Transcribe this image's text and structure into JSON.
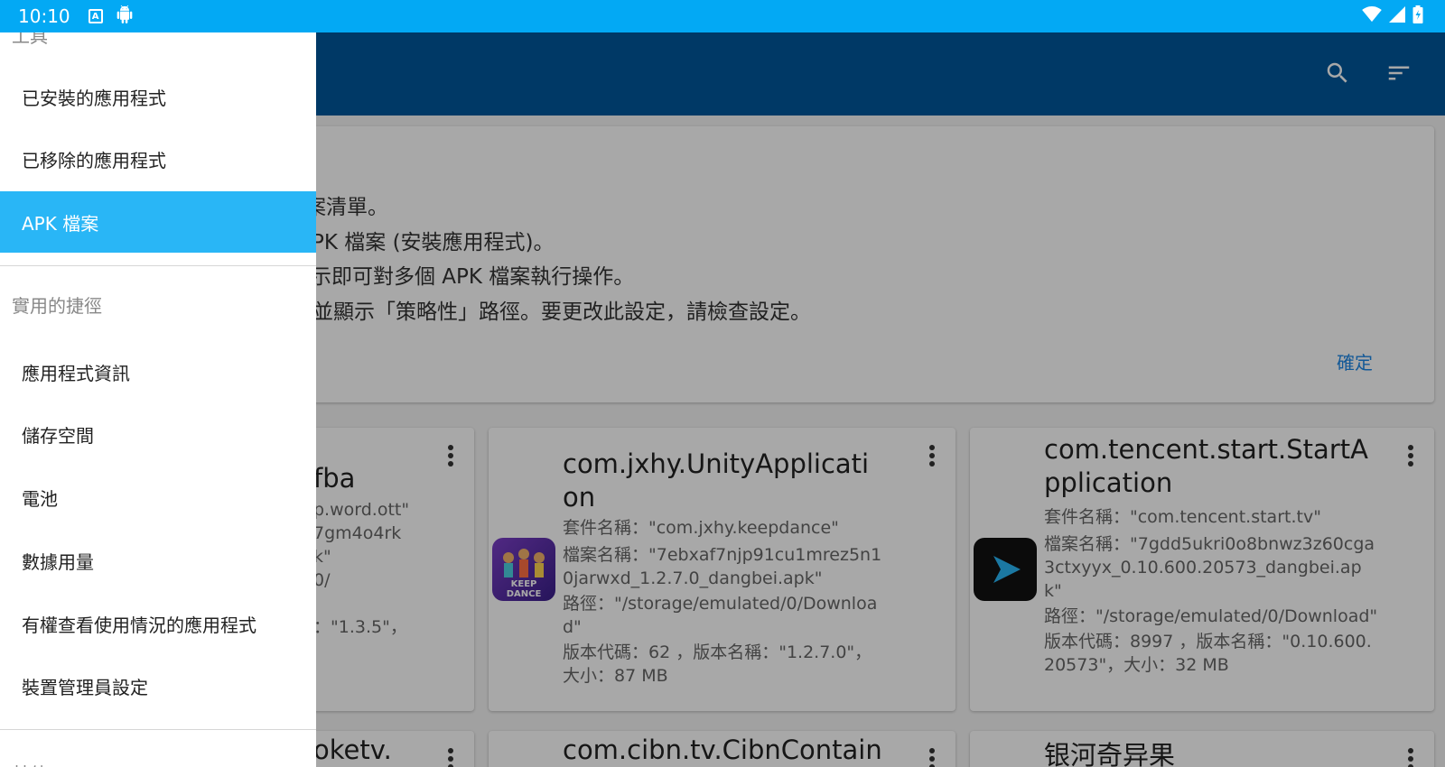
{
  "status_bar": {
    "time": "10:10",
    "notif_a": "A"
  },
  "app_bar": {
    "search_icon": "search-icon",
    "sort_icon": "sort-icon"
  },
  "info_card": {
    "lines": [
      "案清單。",
      "PK 檔案 (安裝應用程式)。",
      "示即可對多個 APK 檔案執行操作。",
      "並顯示「策略性」路徑。要更改此設定，請檢查設定。"
    ],
    "ok_label": "確定"
  },
  "cards": [
    {
      "title": "fba",
      "meta": [
        "p.word.ott\"",
        "7gm4o4rk",
        "k\"",
        "0/",
        "：\"1.3.5\"，"
      ]
    },
    {
      "title": "com.jxhy.UnityApplication",
      "meta": [
        "套件名稱：\"com.jxhy.keepdance\"",
        "檔案名稱：\"7ebxaf7njp91cu1mrez5n10jarwxd_1.2.7.0_dangbei.apk\"",
        "路徑：\"/storage/emulated/0/Download\"",
        "版本代碼：62 ，版本名稱：\"1.2.7.0\"，大小：87 MB"
      ],
      "icon_text": "KEEP DANCE"
    },
    {
      "title": "com.tencent.start.StartApplication",
      "meta": [
        "套件名稱：\"com.tencent.start.tv\"",
        "檔案名稱：\"7gdd5ukri0o8bnwz3z60cga3ctxyyx_0.10.600.20573_dangbei.apk\"",
        "路徑：\"/storage/emulated/0/Download\"",
        "版本代碼：8997 ，版本名稱：\"0.10.600.20573\"，大小：32 MB"
      ]
    }
  ],
  "cards_row2": [
    "oketv.",
    "com.cibn.tv.CibnContain",
    "银河奇异果"
  ],
  "drawer": {
    "top_section": "工具",
    "tools": [
      "已安裝的應用程式",
      "已移除的應用程式",
      "APK 檔案"
    ],
    "shortcuts_section": "實用的捷徑",
    "shortcuts": [
      "應用程式資訊",
      "儲存空間",
      "電池",
      "數據用量",
      "有權查看使用情況的應用程式",
      "裝置管理員設定"
    ],
    "other_section": "其他"
  }
}
